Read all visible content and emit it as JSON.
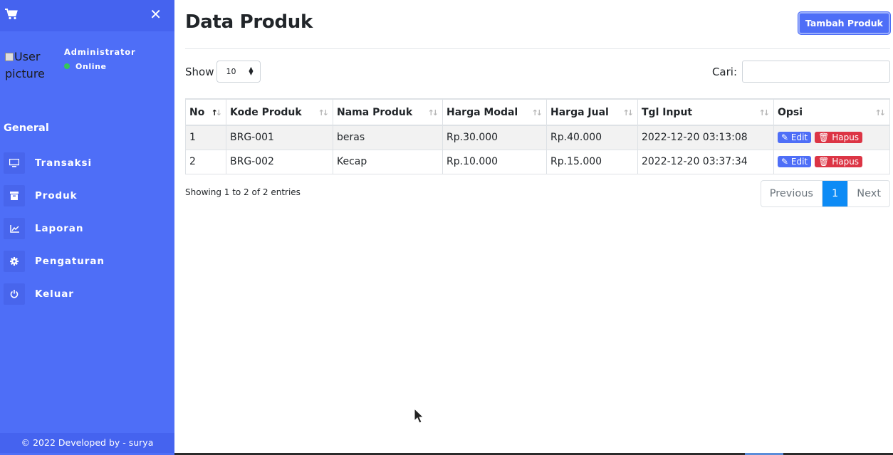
{
  "sidebar": {
    "cart_icon": "shopping-cart-icon",
    "close_icon": "close-icon",
    "user": {
      "picture_alt": "User picture",
      "name": "Administrator",
      "status": "Online"
    },
    "heading": "General",
    "menu": [
      {
        "label": "Transaksi",
        "icon": "monitor-icon"
      },
      {
        "label": "Produk",
        "icon": "archive-icon"
      },
      {
        "label": "Laporan",
        "icon": "chart-icon"
      },
      {
        "label": "Pengaturan",
        "icon": "gear-icon"
      },
      {
        "label": "Keluar",
        "icon": "power-icon"
      }
    ],
    "footer": "© 2022 Developed by - surya"
  },
  "main": {
    "title": "Data Produk",
    "add_button": "Tambah Produk",
    "show_label": "Show",
    "page_size": "10",
    "search_label": "Cari:",
    "search_value": "",
    "columns": [
      "No",
      "Kode Produk",
      "Nama Produk",
      "Harga Modal",
      "Harga Jual",
      "Tgl Input",
      "Opsi"
    ],
    "rows": [
      {
        "no": "1",
        "kode": "BRG-001",
        "nama": "beras",
        "modal": "Rp.30.000",
        "jual": "Rp.40.000",
        "tgl": "2022-12-20 03:13:08"
      },
      {
        "no": "2",
        "kode": "BRG-002",
        "nama": "Kecap",
        "modal": "Rp.10.000",
        "jual": "Rp.15.000",
        "tgl": "2022-12-20 03:37:34"
      }
    ],
    "edit_label": "Edit",
    "delete_label": "Hapus",
    "info": "Showing 1 to 2 of 2 entries",
    "pager": {
      "previous": "Previous",
      "current": "1",
      "next": "Next"
    }
  },
  "colors": {
    "sidebar": "#4e6ef7",
    "primary": "#4e6ef7",
    "danger": "#dc3545",
    "page_active": "#0d8bf5"
  }
}
